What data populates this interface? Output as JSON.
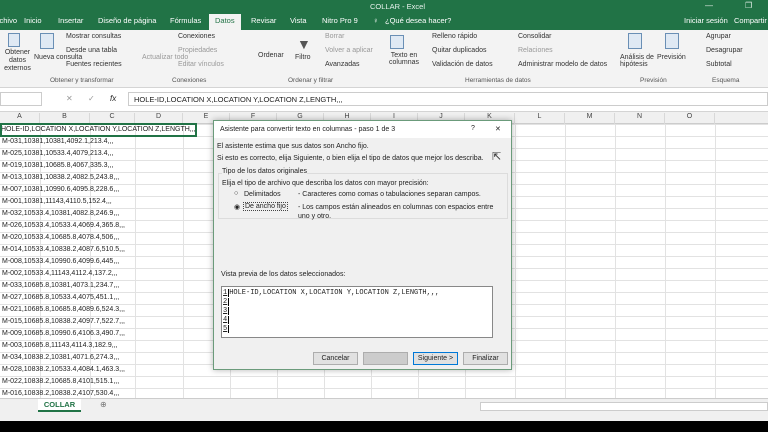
{
  "window": {
    "title": "COLLAR - Excel"
  },
  "tabs": [
    "Archivo",
    "Inicio",
    "Insertar",
    "Diseño de página",
    "Fórmulas",
    "Datos",
    "Revisar",
    "Vista",
    "Nitro Pro 9"
  ],
  "active_tab": "Datos",
  "search_placeholder": "¿Qué desea hacer?",
  "signin": "Iniciar sesión",
  "share": "Compartir",
  "ribbon": {
    "obtener": [
      "Obtener datos externos",
      "Nueva consulta",
      "Mostrar consultas",
      "Desde una tabla",
      "Fuentes recientes"
    ],
    "conexiones": [
      "Actualizar todo",
      "Conexiones",
      "Propiedades",
      "Editar vínculos"
    ],
    "ordenar": [
      "Ordenar",
      "Filtro",
      "Borrar",
      "Volver a aplicar",
      "Avanzadas"
    ],
    "herramientas": [
      "Texto en columnas",
      "Relleno rápido",
      "Quitar duplicados",
      "Validación de datos",
      "Consolidar",
      "Relaciones",
      "Administrar modelo de datos"
    ],
    "prevision": [
      "Análisis de hipótesis",
      "Previsión"
    ],
    "esquema": [
      "Agrupar",
      "Desagrupar",
      "Subtotal"
    ],
    "groups": [
      "Obtener y transformar",
      "Conexiones",
      "Ordenar y filtrar",
      "Herramientas de datos",
      "Previsión",
      "Esquema"
    ]
  },
  "formula": {
    "fx": "fx",
    "value": "HOLE-ID,LOCATION X,LOCATION Y,LOCATION Z,LENGTH,,,"
  },
  "columns": [
    "A",
    "B",
    "C",
    "D",
    "E",
    "F",
    "G",
    "H",
    "I",
    "J",
    "K",
    "L",
    "M",
    "N",
    "O"
  ],
  "rows": [
    "HOLE-ID,LOCATION X,LOCATION Y,LOCATION Z,LENGTH,,,",
    "M-031,10381,10381,4092.1,213.4,,,",
    "M-025,10381,10533.4,4079,213.4,,,",
    "M-019,10381,10685.8,4067,335.3,,,",
    "M-013,10381,10838.2,4082.5,243.8,,,",
    "M-007,10381,10990.6,4095.8,228.6,,,",
    "M-001,10381,11143,4110.5,152.4,,,",
    "M-032,10533.4,10381,4082.8,246.9,,,",
    "M-026,10533.4,10533.4,4069.4,365.8,,,",
    "M-020,10533.4,10685.8,4078.4,506,,,",
    "M-014,10533.4,10838.2,4087.6,510.5,,,",
    "M-008,10533.4,10990.6,4099.6,445,,,",
    "M-002,10533.4,11143,4112.4,137.2,,,",
    "M-033,10685.8,10381,4073.1,234.7,,,",
    "M-027,10685.8,10533.4,4075,451.1,,,",
    "M-021,10685.8,10685.8,4089.6,524.3,,,",
    "M-015,10685.8,10838.2,4097.7,522.7,,,",
    "M-009,10685.8,10990.6,4106.3,490.7,,,",
    "M-003,10685.8,11143,4114.3,182.9,,,",
    "M-034,10838.2,10381,4071.6,274.3,,,",
    "M-028,10838.2,10533.4,4084.1,463.3,,,",
    "M-022,10838.2,10685.8,4101,515.1,,,",
    "M-016,10838.2,10838.2,4107,530.4,,,"
  ],
  "sheet_tab": "COLLAR",
  "dialog": {
    "title": "Asistente para convertir texto en columnas - paso 1 de 3",
    "help": "?",
    "close": "✕",
    "line1": "El asistente estima que sus datos son Ancho fijo.",
    "line2": "Si esto es correcto, elija Siguiente, o bien elija el tipo de datos que mejor los describa.",
    "group": "Tipo de los datos originales",
    "prompt": "Elija el tipo de archivo que describa los datos con mayor precisión:",
    "opt1": "Delimitados",
    "opt1_desc": "- Caracteres como comas o tabulaciones separan campos.",
    "opt2": "De ancho fijo",
    "opt2_desc": "- Los campos están alineados en columnas con espacios entre uno y otro.",
    "selected": "De ancho fijo",
    "preview_label": "Vista previa de los datos seleccionados:",
    "preview_lines": [
      "HOLE-ID,LOCATION X,LOCATION Y,LOCATION Z,LENGTH,,,",
      "",
      "",
      "",
      ""
    ],
    "line_numbers": [
      "1",
      "2",
      "3",
      "4",
      "5"
    ],
    "cancel": "Cancelar",
    "back": "< Atrás",
    "next": "Siguiente >",
    "finish": "Finalizar"
  },
  "colors": {
    "excel_green": "#217346"
  }
}
